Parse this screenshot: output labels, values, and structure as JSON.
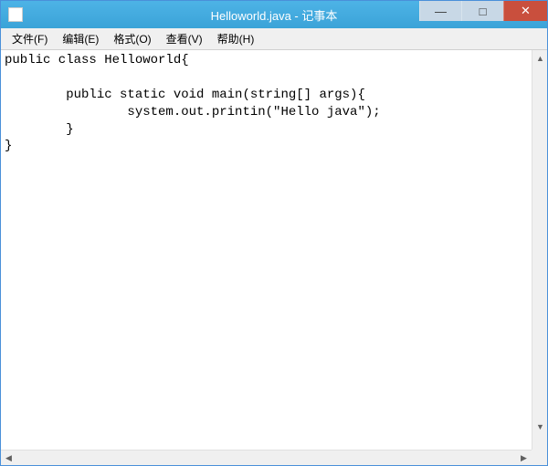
{
  "window": {
    "title": "Helloworld.java - 记事本"
  },
  "menu": {
    "file": "文件(F)",
    "edit": "编辑(E)",
    "format": "格式(O)",
    "view": "查看(V)",
    "help": "帮助(H)"
  },
  "controls": {
    "minimize": "—",
    "maximize": "□",
    "close": "✕"
  },
  "scroll": {
    "up": "▲",
    "down": "▼",
    "left": "◀",
    "right": "▶"
  },
  "editor": {
    "content": "public class Helloworld{\n\n        public static void main(string[] args){\n                system.out.printin(\"Hello java\");\n        }\n}"
  }
}
